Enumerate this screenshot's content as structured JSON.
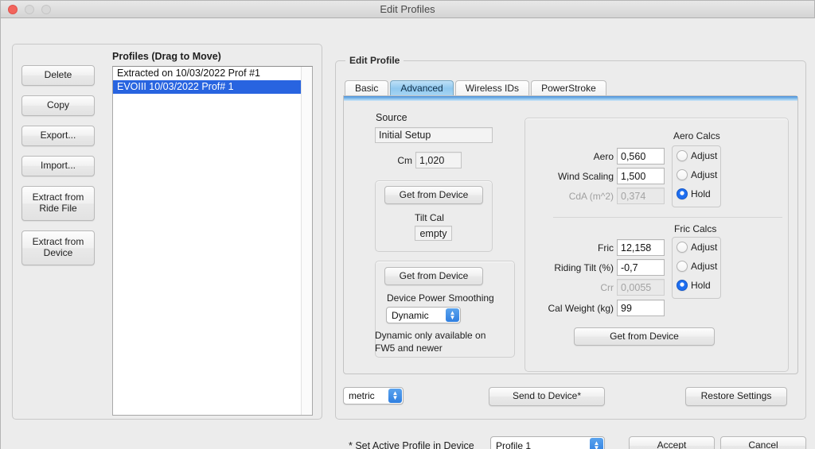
{
  "window": {
    "title": "Edit Profiles",
    "traffic_lights": [
      "close-button",
      "minimize-button",
      "maximize-button"
    ]
  },
  "sidebar": {
    "buttons": [
      {
        "label": "Delete"
      },
      {
        "label": "Copy"
      },
      {
        "label": "Export..."
      },
      {
        "label": "Import..."
      },
      {
        "label": "Extract from\nRide File",
        "line1": "Extract from",
        "line2": "Ride File"
      },
      {
        "label": "Extract from\nDevice",
        "line1": "Extract from",
        "line2": "Device"
      }
    ]
  },
  "profiles": {
    "title": "Profiles (Drag to Move)",
    "items": [
      {
        "label": "Extracted on 10/03/2022 Prof #1",
        "selected": false
      },
      {
        "label": "EVOIII 10/03/2022 Prof# 1",
        "selected": true
      }
    ],
    "selection_color": "#2864e0"
  },
  "edit_profile": {
    "group_title": "Edit Profile",
    "tabs": [
      {
        "label": "Basic",
        "active": false
      },
      {
        "label": "Advanced",
        "active": true
      },
      {
        "label": "Wireless IDs",
        "active": false
      },
      {
        "label": "PowerStroke",
        "active": false
      }
    ],
    "source": {
      "label": "Source",
      "value": "Initial Setup",
      "cm_label": "Cm",
      "cm_value": "1,020"
    },
    "tilt_panel": {
      "get_from_device": "Get from Device",
      "tilt_cal_label": "Tilt Cal",
      "tilt_cal_value": "empty"
    },
    "smoothing_panel": {
      "get_from_device": "Get from Device",
      "label": "Device Power Smoothing",
      "selected": "Dynamic",
      "note_line1": "Dynamic only available on",
      "note_line2": "FW5 and newer"
    },
    "aero": {
      "title": "Aero Calcs",
      "fields": [
        {
          "label": "Aero",
          "value": "0,560",
          "disabled": false
        },
        {
          "label": "Wind Scaling",
          "value": "1,500",
          "disabled": false
        },
        {
          "label": "CdA (m^2)",
          "value": "0,374",
          "disabled": true
        }
      ],
      "radios": [
        {
          "label": "Adjust",
          "selected": false
        },
        {
          "label": "Adjust",
          "selected": false
        },
        {
          "label": "Hold",
          "selected": true
        }
      ]
    },
    "fric": {
      "title": "Fric Calcs",
      "fields": [
        {
          "label": "Fric",
          "value": "12,158",
          "disabled": false
        },
        {
          "label": "Riding Tilt (%)",
          "value": "-0,7",
          "disabled": false
        },
        {
          "label": "Crr",
          "value": "0,0055",
          "disabled": true
        }
      ],
      "radios": [
        {
          "label": "Adjust",
          "selected": false
        },
        {
          "label": "Adjust",
          "selected": false
        },
        {
          "label": "Hold",
          "selected": true
        }
      ],
      "cal_weight_label": "Cal Weight (kg)",
      "cal_weight_value": "99",
      "get_from_device": "Get from Device"
    }
  },
  "toolbar": {
    "units_value": "metric",
    "send_to_device": "Send to Device*",
    "restore_settings": "Restore Settings"
  },
  "footer": {
    "active_profile_label": "* Set Active Profile in Device",
    "active_profile_value": "Profile 1",
    "accept": "Accept",
    "cancel": "Cancel"
  }
}
